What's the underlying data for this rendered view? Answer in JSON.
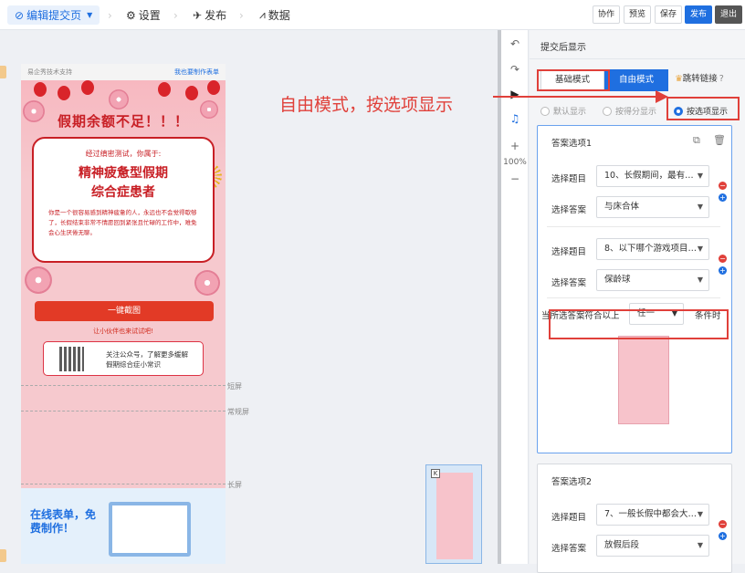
{
  "topbar": {
    "edit_page": "编辑提交页",
    "settings": "设置",
    "publish": "发布",
    "data": "数据",
    "collab": "协作",
    "preview": "预览",
    "save": "保存",
    "publish_btn": "发布",
    "exit": "退出"
  },
  "phone": {
    "brand": "易企秀技术支持",
    "make_form": "我也要制作表单",
    "title": "假期余额不足！！！",
    "card_line1": "经过缜密测试，你属于:",
    "card_line2": "精神疲惫型假期",
    "card_line3": "综合症患者",
    "card_desc": "你是一个很容易感到精神疲惫的人，永远也不会觉得歇够了，长假结束非常不情愿回到紧张且忙碌的工作中，难免会心生厌倦无聊。",
    "screenshot_btn": "一键截图",
    "share_text": "让小伙伴也来试试吧!",
    "qr_text": "关注公众号，了解更多缓解假期综合症小常识",
    "short_screen": "短屏",
    "normal_screen": "常规屏",
    "long_screen": "长屏",
    "banner_text": "在线表单，免费制作！"
  },
  "tools": {
    "zoom": "100%",
    "zoom_in": "+",
    "zoom_out": "−"
  },
  "panel": {
    "title": "提交后显示",
    "tabs": [
      "基础模式",
      "自由模式",
      "跳转链接"
    ],
    "radio_default": "默认显示",
    "radio_score": "按得分显示",
    "radio_option": "按选项显示",
    "card1": {
      "title": "答案选项1",
      "q1_label": "选择题目",
      "q1_value": "10、长假期间，最有…",
      "a1_label": "选择答案",
      "a1_value": "与床合体",
      "q2_label": "选择题目",
      "q2_value": "8、以下哪个游戏项目…",
      "a2_label": "选择答案",
      "a2_value": "保龄球",
      "cond_prefix": "当所选答案符合以上",
      "cond_value": "任一",
      "cond_suffix": "条件时"
    },
    "card2": {
      "title": "答案选项2",
      "q1_label": "选择题目",
      "q1_value": "7、一般长假中都会大…",
      "a1_label": "选择答案",
      "a1_value": "放假后段"
    }
  },
  "annotation": "自由模式，按选项显示",
  "colors": {
    "accent": "#1f6fe0",
    "annotation_red": "#e0403a",
    "poster_red": "#c81f25"
  }
}
